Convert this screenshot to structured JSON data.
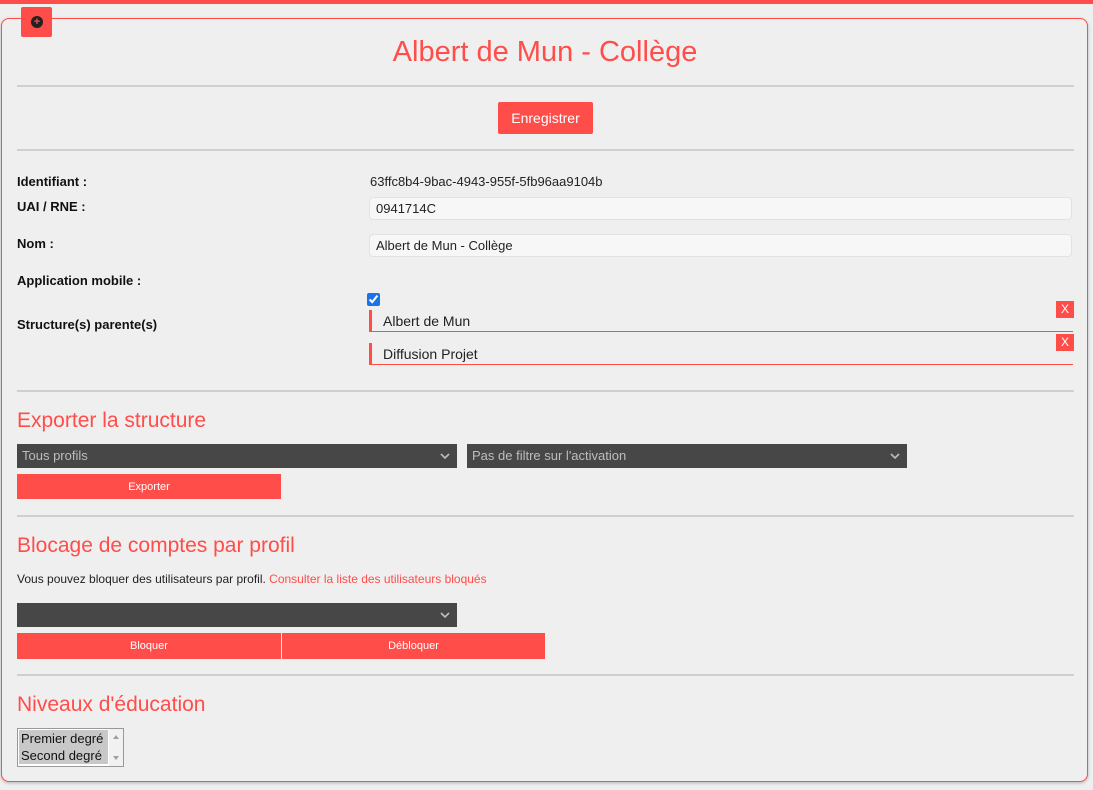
{
  "header": {
    "title": "Albert de Mun - Collège",
    "save_label": "Enregistrer"
  },
  "fields": {
    "id_label": "Identifiant :",
    "id_value": "63ffc8b4-9bac-4943-955f-5fb96aa9104b",
    "uai_label": "UAI / RNE :",
    "uai_value": "0941714C",
    "nom_label": "Nom :",
    "nom_value": "Albert de Mun - Collège",
    "mobile_label": "Application mobile :",
    "mobile_checked": true,
    "parents_label": "Structure(s) parente(s)",
    "parents": [
      {
        "name": "Albert de Mun",
        "remove": "X"
      },
      {
        "name": "Diffusion Projet",
        "remove": "X"
      }
    ]
  },
  "export": {
    "title": "Exporter la structure",
    "profile_select": "Tous profils",
    "activation_select": "Pas de filtre sur l'activation",
    "export_label": "Exporter"
  },
  "blocking": {
    "title": "Blocage de comptes par profil",
    "description": "Vous pouvez bloquer des utilisateurs par profil.",
    "link": "Consulter la liste des utilisateurs bloqués",
    "profile_select": "",
    "block_label": "Bloquer",
    "unblock_label": "Débloquer"
  },
  "levels": {
    "title": "Niveaux d'éducation",
    "options": [
      "Premier degré",
      "Second degré"
    ]
  },
  "colors": {
    "accent": "#ff4d4a",
    "select_bg": "#474747"
  },
  "icons": {
    "top_button": "plus-circle-icon",
    "select_arrow": "chevron-down-icon"
  }
}
